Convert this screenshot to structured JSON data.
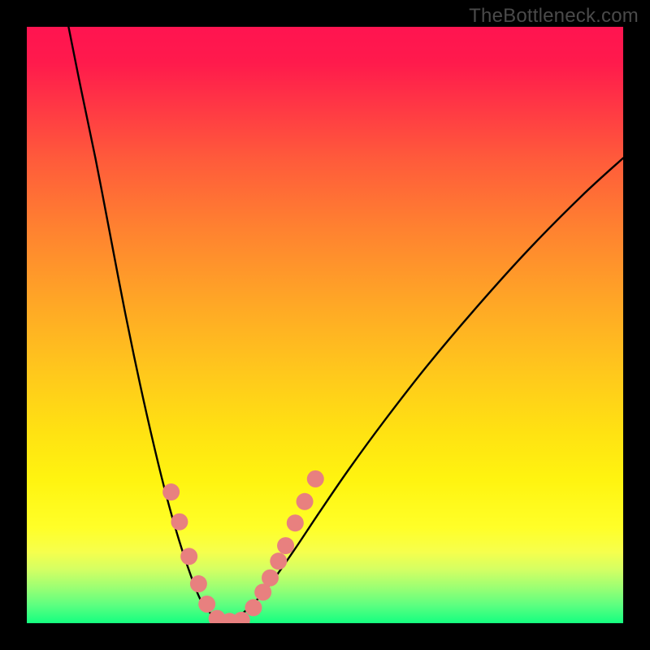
{
  "watermark": {
    "text": "TheBottleneck.com"
  },
  "layout": {
    "imageSize": 800,
    "plotOffset": 33,
    "plotSize": 734
  },
  "chart_data": {
    "type": "line",
    "title": "",
    "xlabel": "",
    "ylabel": "",
    "xlim": [
      0,
      100
    ],
    "ylim": [
      0,
      100
    ],
    "grid": false,
    "annotations": [],
    "series": [
      {
        "name": "left-branch",
        "stroke": "#000000",
        "strokeWidth": 2.4,
        "x": [
          7.0,
          9.0,
          11.5,
          14.0,
          16.5,
          19.0,
          21.5,
          23.5,
          25.5,
          27.5,
          29.0,
          30.5,
          31.6,
          32.5,
          33.0
        ],
        "y": [
          100.0,
          90.0,
          78.0,
          65.0,
          52.0,
          40.0,
          29.0,
          21.0,
          14.0,
          8.0,
          4.2,
          2.0,
          0.8,
          0.2,
          0.0
        ]
      },
      {
        "name": "right-branch",
        "stroke": "#000000",
        "strokeWidth": 2.4,
        "x": [
          33.0,
          34.0,
          36.0,
          38.5,
          41.5,
          45.0,
          49.0,
          54.0,
          60.0,
          67.0,
          75.0,
          84.0,
          93.0,
          100.0
        ],
        "y": [
          0.0,
          0.3,
          1.5,
          3.8,
          7.5,
          12.5,
          18.5,
          25.8,
          34.0,
          43.0,
          52.5,
          62.5,
          71.6,
          78.0
        ]
      }
    ],
    "markers": {
      "fill": "#e8807f",
      "radius": 10.5,
      "points": [
        {
          "x": 24.2,
          "y": 22.0
        },
        {
          "x": 25.6,
          "y": 17.0
        },
        {
          "x": 27.2,
          "y": 11.2
        },
        {
          "x": 28.8,
          "y": 6.6
        },
        {
          "x": 30.2,
          "y": 3.2
        },
        {
          "x": 31.9,
          "y": 0.8
        },
        {
          "x": 34.0,
          "y": 0.3
        },
        {
          "x": 36.0,
          "y": 0.5
        },
        {
          "x": 38.0,
          "y": 2.6
        },
        {
          "x": 39.6,
          "y": 5.2
        },
        {
          "x": 40.8,
          "y": 7.6
        },
        {
          "x": 42.2,
          "y": 10.4
        },
        {
          "x": 43.4,
          "y": 13.0
        },
        {
          "x": 45.0,
          "y": 16.8
        },
        {
          "x": 46.6,
          "y": 20.4
        },
        {
          "x": 48.4,
          "y": 24.2
        }
      ]
    }
  }
}
